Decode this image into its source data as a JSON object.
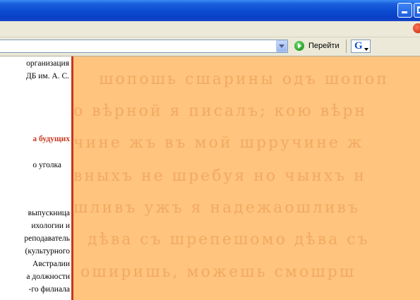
{
  "toolbar": {
    "go_label": "Перейти",
    "google_label": "G"
  },
  "address": {
    "url": ""
  },
  "left_column": {
    "lines": [
      "организация",
      "ДБ им. А. С.",
      "а будущих",
      "о уголка",
      "выпускница",
      "ихологии и",
      "реподаватель",
      "(культурного",
      "Австралии",
      "а должности",
      "-го филиала"
    ]
  },
  "background_text": {
    "lines": [
      "шопошь сшарины одъ шопоп",
      "о вѣрной я писалъ; кою вѣрн",
      "чине жъ въ мой шрручине ж",
      "вныхъ не шребуя но  чынхъ н",
      "шливъ ужъ я надежаошливъ",
      "дѣва съ шрепешомо дѣва съ",
      "оширишь, можешь смошрш"
    ]
  },
  "colors": {
    "titlebar": "#0a4ad0",
    "panel_bg": "#ffc47e",
    "accent_red": "#c8361d"
  }
}
